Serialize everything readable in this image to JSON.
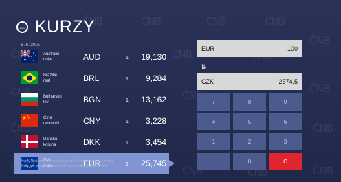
{
  "header": {
    "title": "KURZY"
  },
  "watermark": "ČNB",
  "date": "5. 6. 2015",
  "rates": [
    {
      "country": "Austrálie",
      "currency_name": "dolar",
      "code": "AUD",
      "amount": "1",
      "rate": "19,130",
      "flag": "australia-flag"
    },
    {
      "country": "Brazílie",
      "currency_name": "real",
      "code": "BRL",
      "amount": "1",
      "rate": "9,284",
      "flag": "brazil-flag"
    },
    {
      "country": "Bulharsko",
      "currency_name": "lev",
      "code": "BGN",
      "amount": "1",
      "rate": "13,162",
      "flag": "bulgaria-flag"
    },
    {
      "country": "Čína",
      "currency_name": "renminbi",
      "code": "CNY",
      "amount": "1",
      "rate": "3,228",
      "flag": "china-flag"
    },
    {
      "country": "Dánsko",
      "currency_name": "koruna",
      "code": "DKK",
      "amount": "1",
      "rate": "3,454",
      "flag": "denmark-flag"
    },
    {
      "country": "EMU",
      "currency_name": "euro",
      "code": "EUR",
      "amount": "1",
      "rate": "25,745",
      "flag": "eu-flag",
      "selected": true
    }
  ],
  "footnote_line1": "Kurzy devizového trhu vyhlašované Českou národní bankou.",
  "footnote_line2": "Data pro aktuální pracovní den jsou k dispozici po 14:30.",
  "converter": {
    "from_code": "EUR",
    "from_value": "100",
    "to_code": "CZK",
    "to_value": "2574,5",
    "swap_icon": "swap-arrows-icon"
  },
  "keypad": {
    "keys": [
      "7",
      "8",
      "9",
      "4",
      "5",
      "6",
      "1",
      "2",
      "3",
      ",",
      "0",
      "C"
    ]
  },
  "colors": {
    "accent": "#8195d2",
    "clear": "#e0252e",
    "key": "#4c5a8e",
    "field": "#d8d8d8"
  }
}
